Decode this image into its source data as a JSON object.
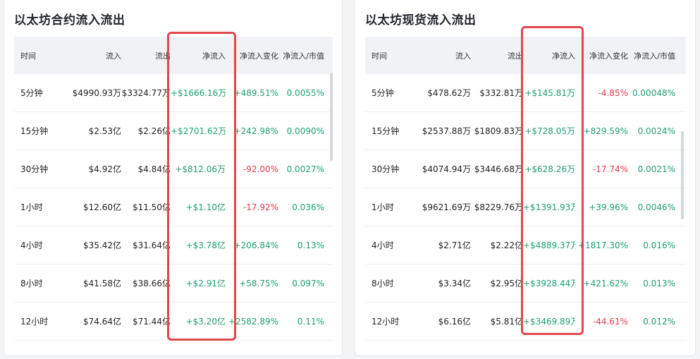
{
  "colors": {
    "positive": "#1d9e74",
    "negative": "#e5384b",
    "highlight": "#e2474e"
  },
  "contract": {
    "title": "以太坊合约流入流出",
    "headers": [
      "时间",
      "流入",
      "流出",
      "净流入",
      "净流入变化",
      "净流入/市值"
    ],
    "rows": [
      {
        "time": "5分钟",
        "inflow": "$4990.93万",
        "outflow": "$3324.77万",
        "net": "+$1666.16万",
        "change": "+489.51%",
        "ratio": "0.0055%"
      },
      {
        "time": "15分钟",
        "inflow": "$2.53亿",
        "outflow": "$2.26亿",
        "net": "+$2701.62万",
        "change": "+242.98%",
        "ratio": "0.0090%"
      },
      {
        "time": "30分钟",
        "inflow": "$4.92亿",
        "outflow": "$4.84亿",
        "net": "+$812.06万",
        "change": "-92.00%",
        "ratio": "0.0027%"
      },
      {
        "time": "1小时",
        "inflow": "$12.60亿",
        "outflow": "$11.50亿",
        "net": "+$1.10亿",
        "change": "-17.92%",
        "ratio": "0.036%"
      },
      {
        "time": "4小时",
        "inflow": "$35.42亿",
        "outflow": "$31.64亿",
        "net": "+$3.78亿",
        "change": "+206.84%",
        "ratio": "0.13%"
      },
      {
        "time": "8小时",
        "inflow": "$41.58亿",
        "outflow": "$38.66亿",
        "net": "+$2.91亿",
        "change": "+58.75%",
        "ratio": "0.097%"
      },
      {
        "time": "12小时",
        "inflow": "$74.64亿",
        "outflow": "$71.44亿",
        "net": "+$3.20亿",
        "change": "+2582.89%",
        "ratio": "0.11%"
      }
    ]
  },
  "spot": {
    "title": "以太坊现货流入流出",
    "headers": [
      "时间",
      "流入",
      "流出",
      "净流入",
      "净流入变化",
      "净流入/市值"
    ],
    "rows": [
      {
        "time": "5分钟",
        "inflow": "$478.62万",
        "outflow": "$332.81万",
        "net": "+$145.81万",
        "change": "-4.85%",
        "ratio": "0.00048%"
      },
      {
        "time": "15分钟",
        "inflow": "$2537.88万",
        "outflow": "$1809.83万",
        "net": "+$728.05万",
        "change": "+829.59%",
        "ratio": "0.0024%"
      },
      {
        "time": "30分钟",
        "inflow": "$4074.94万",
        "outflow": "$3446.68万",
        "net": "+$628.26万",
        "change": "-17.74%",
        "ratio": "0.0021%"
      },
      {
        "time": "1小时",
        "inflow": "$9621.69万",
        "outflow": "$8229.76万",
        "net": "+$1391.93万",
        "change": "+39.96%",
        "ratio": "0.0046%"
      },
      {
        "time": "4小时",
        "inflow": "$2.71亿",
        "outflow": "$2.22亿",
        "net": "+$4889.37万",
        "change": "+1817.30%",
        "ratio": "0.016%"
      },
      {
        "time": "8小时",
        "inflow": "$3.34亿",
        "outflow": "$2.95亿",
        "net": "+$3928.44万",
        "change": "+421.62%",
        "ratio": "0.013%"
      },
      {
        "time": "12小时",
        "inflow": "$6.16亿",
        "outflow": "$5.81亿",
        "net": "+$3469.89万",
        "change": "-44.61%",
        "ratio": "0.012%"
      }
    ]
  }
}
